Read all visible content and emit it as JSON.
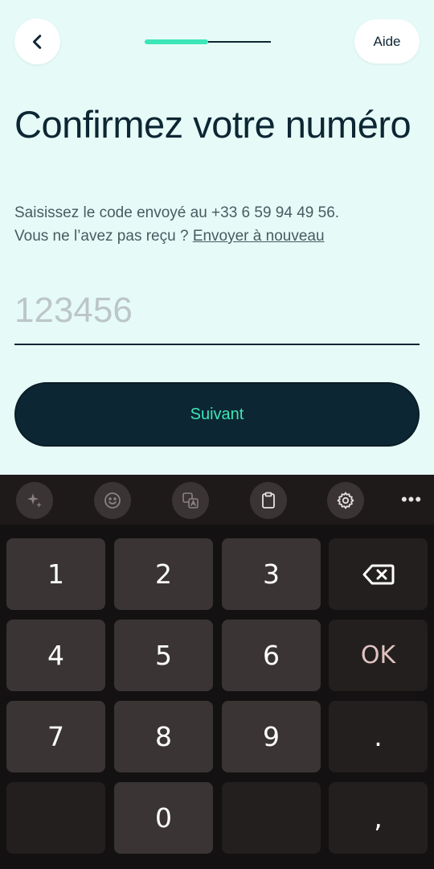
{
  "header": {
    "back_icon": "chevron-left-icon",
    "progress": 0.5,
    "help_label": "Aide"
  },
  "main": {
    "title": "Confirmez votre numéro",
    "subtitle_line1": "Saisissez le code envoyé au +33 6 59 94 49 56.",
    "subtitle_line2_prefix": "Vous ne l’avez pas reçu ? ",
    "resend_link": "Envoyer à nouveau",
    "code_placeholder": "123456",
    "code_value": "",
    "next_label": "Suivant"
  },
  "keyboard": {
    "toolbar_icons": [
      "sparkle-icon",
      "emoji-icon",
      "translate-icon",
      "clipboard-icon",
      "settings-icon",
      "more-icon"
    ],
    "more_label": "•••",
    "keys": [
      "1",
      "2",
      "3",
      "backspace",
      "4",
      "5",
      "6",
      "OK",
      "7",
      "8",
      "9",
      ".",
      "",
      "0",
      "",
      ","
    ]
  },
  "colors": {
    "background": "#e6fbf8",
    "primary_dark": "#0d2633",
    "accent": "#3ce6b7",
    "keyboard_bg": "#131111",
    "key_bg": "#3a3434"
  }
}
